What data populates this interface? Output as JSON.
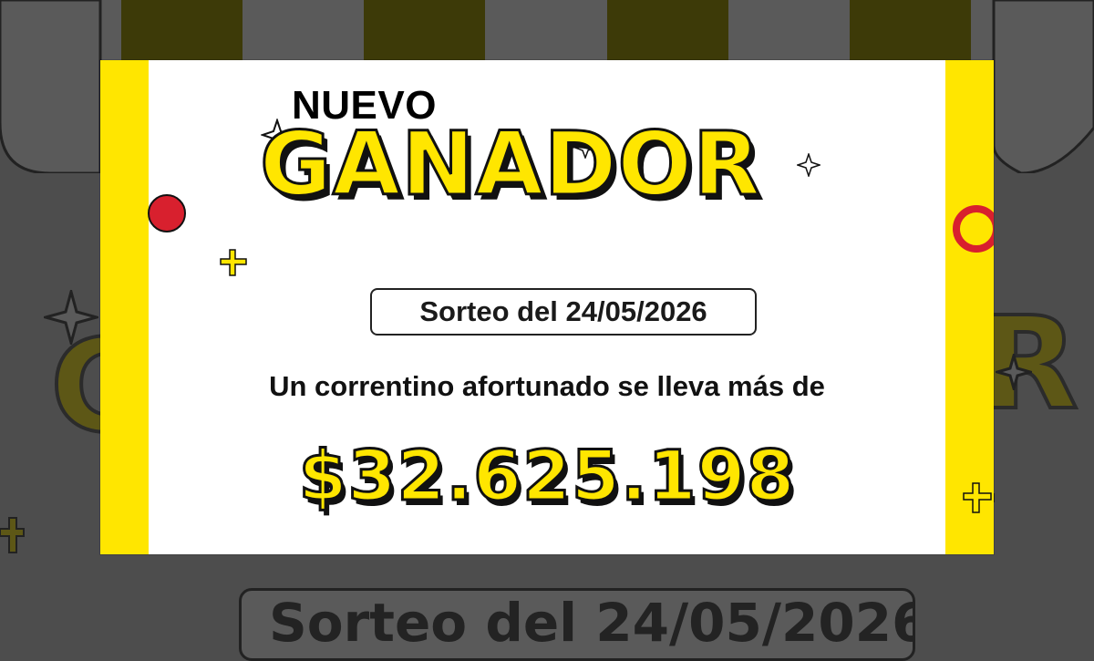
{
  "colors": {
    "accent_yellow": "#ffe600",
    "dim_yellow": "#3d3a08",
    "red": "#d8202e",
    "ink": "#111111",
    "overlay": "#4d4d4d"
  },
  "card": {
    "eyebrow": "NUEVO",
    "headline": "GANADOR",
    "draw_date_label": "Sorteo del 24/05/2026",
    "subtitle": "Un correntino afortunado se lleva más de",
    "amount": "$32.625.198"
  },
  "background": {
    "headline_fragment_left": "G",
    "headline_fragment_right": "R",
    "pill_label": "Sorteo del 24/05/2026"
  },
  "icons": [
    "sparkle-icon",
    "circle-icon",
    "ring-icon",
    "plus-icon"
  ]
}
